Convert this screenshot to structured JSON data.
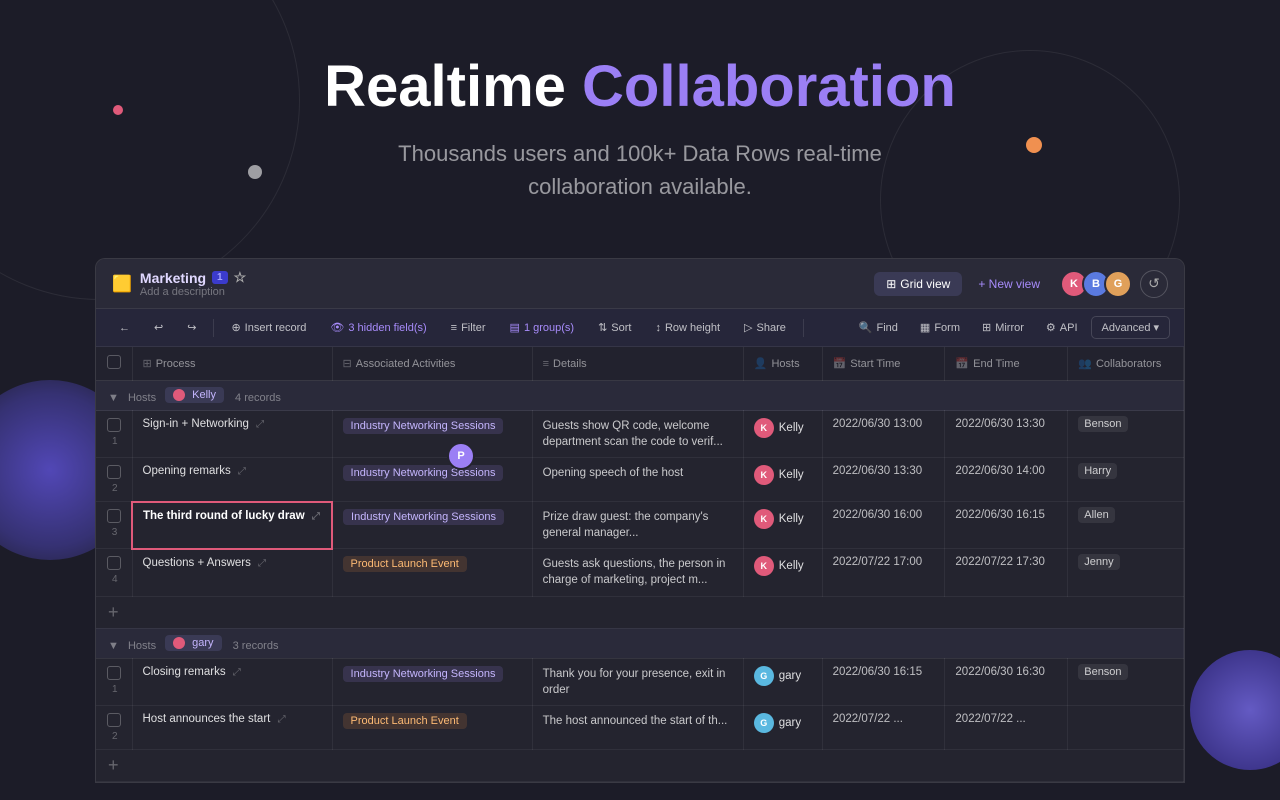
{
  "hero": {
    "title_plain": "Realtime ",
    "title_accent": "Collaboration",
    "subtitle_line1": "Thousands users and 100k+ Data Rows real-time",
    "subtitle_line2": "collaboration available."
  },
  "database": {
    "icon": "🟨",
    "title": "Marketing",
    "badge": "1",
    "star": "☆",
    "description": "Add a description",
    "views": {
      "active": "Grid view",
      "new_view": "+ New view"
    },
    "avatars": [
      "K",
      "B",
      "G"
    ],
    "toolbar": {
      "insert_record": "Insert record",
      "hidden_fields": "3 hidden field(s)",
      "filter": "Filter",
      "group": "1 group(s)",
      "sort": "Sort",
      "row_height": "Row height",
      "share": "Share",
      "find": "Find",
      "form": "Form",
      "mirror": "Mirror",
      "api": "API",
      "advanced": "Advanced"
    },
    "columns": [
      {
        "icon": "⊞",
        "label": "Process"
      },
      {
        "icon": "⊟",
        "label": "Associated Activities"
      },
      {
        "icon": "≡",
        "label": "Details"
      },
      {
        "icon": "👤",
        "label": "Hosts"
      },
      {
        "icon": "📅",
        "label": "Start Time"
      },
      {
        "icon": "📅",
        "label": "End Time"
      },
      {
        "icon": "👥",
        "label": "Collaborators"
      }
    ],
    "groups": [
      {
        "label": "Hosts",
        "tag": "Kelly",
        "count": "4 records",
        "rows": [
          {
            "num": "1",
            "process": "Sign-in + Networking",
            "activity": "Industry Networking Sessions",
            "activity_type": "purple",
            "details": "Guests show QR code, welcome department scan the code to verif...",
            "host": "Kelly",
            "host_class": "ha-kelly",
            "start": "2022/06/30 13:00",
            "end": "2022/06/30 13:30",
            "collab": "Benson",
            "editing": false
          },
          {
            "num": "2",
            "process": "Opening remarks",
            "activity": "Industry Networking Sessions",
            "activity_type": "purple",
            "details": "Opening speech of the host",
            "host": "Kelly",
            "host_class": "ha-kelly",
            "start": "2022/06/30 13:30",
            "end": "2022/06/30 14:00",
            "collab": "Harry",
            "editing": false,
            "has_floating_avatar": true
          },
          {
            "num": "3",
            "process": "The third round of lucky draw",
            "activity": "Industry Networking Sessions",
            "activity_type": "purple",
            "details": "Prize draw guest: the company's general manager...",
            "host": "Kelly",
            "host_class": "ha-kelly",
            "start": "2022/06/30 16:00",
            "end": "2022/06/30 16:15",
            "collab": "Allen",
            "editing": true
          },
          {
            "num": "4",
            "process": "Questions + Answers",
            "activity": "Product Launch Event",
            "activity_type": "orange",
            "details": "Guests ask questions, the person in charge of marketing, project m...",
            "host": "Kelly",
            "host_class": "ha-kelly",
            "start": "2022/07/22 17:00",
            "end": "2022/07/22 17:30",
            "collab": "Jenny",
            "editing": false
          }
        ]
      },
      {
        "label": "Hosts",
        "tag": "gary",
        "count": "3 records",
        "rows": [
          {
            "num": "1",
            "process": "Closing remarks",
            "activity": "Industry Networking Sessions",
            "activity_type": "purple",
            "details": "Thank you for your presence, exit in order",
            "host": "gary",
            "host_class": "ha-gary",
            "start": "2022/06/30 16:15",
            "end": "2022/06/30 16:30",
            "collab": "Benson",
            "editing": false
          },
          {
            "num": "2",
            "process": "Host announces the start",
            "activity": "Product Launch Event",
            "activity_type": "orange",
            "details": "The host announced the start of th...",
            "host": "gary",
            "host_class": "ha-gary",
            "start": "2022/07/22 ...",
            "end": "2022/07/22 ...",
            "collab": "",
            "editing": false
          }
        ]
      }
    ]
  }
}
